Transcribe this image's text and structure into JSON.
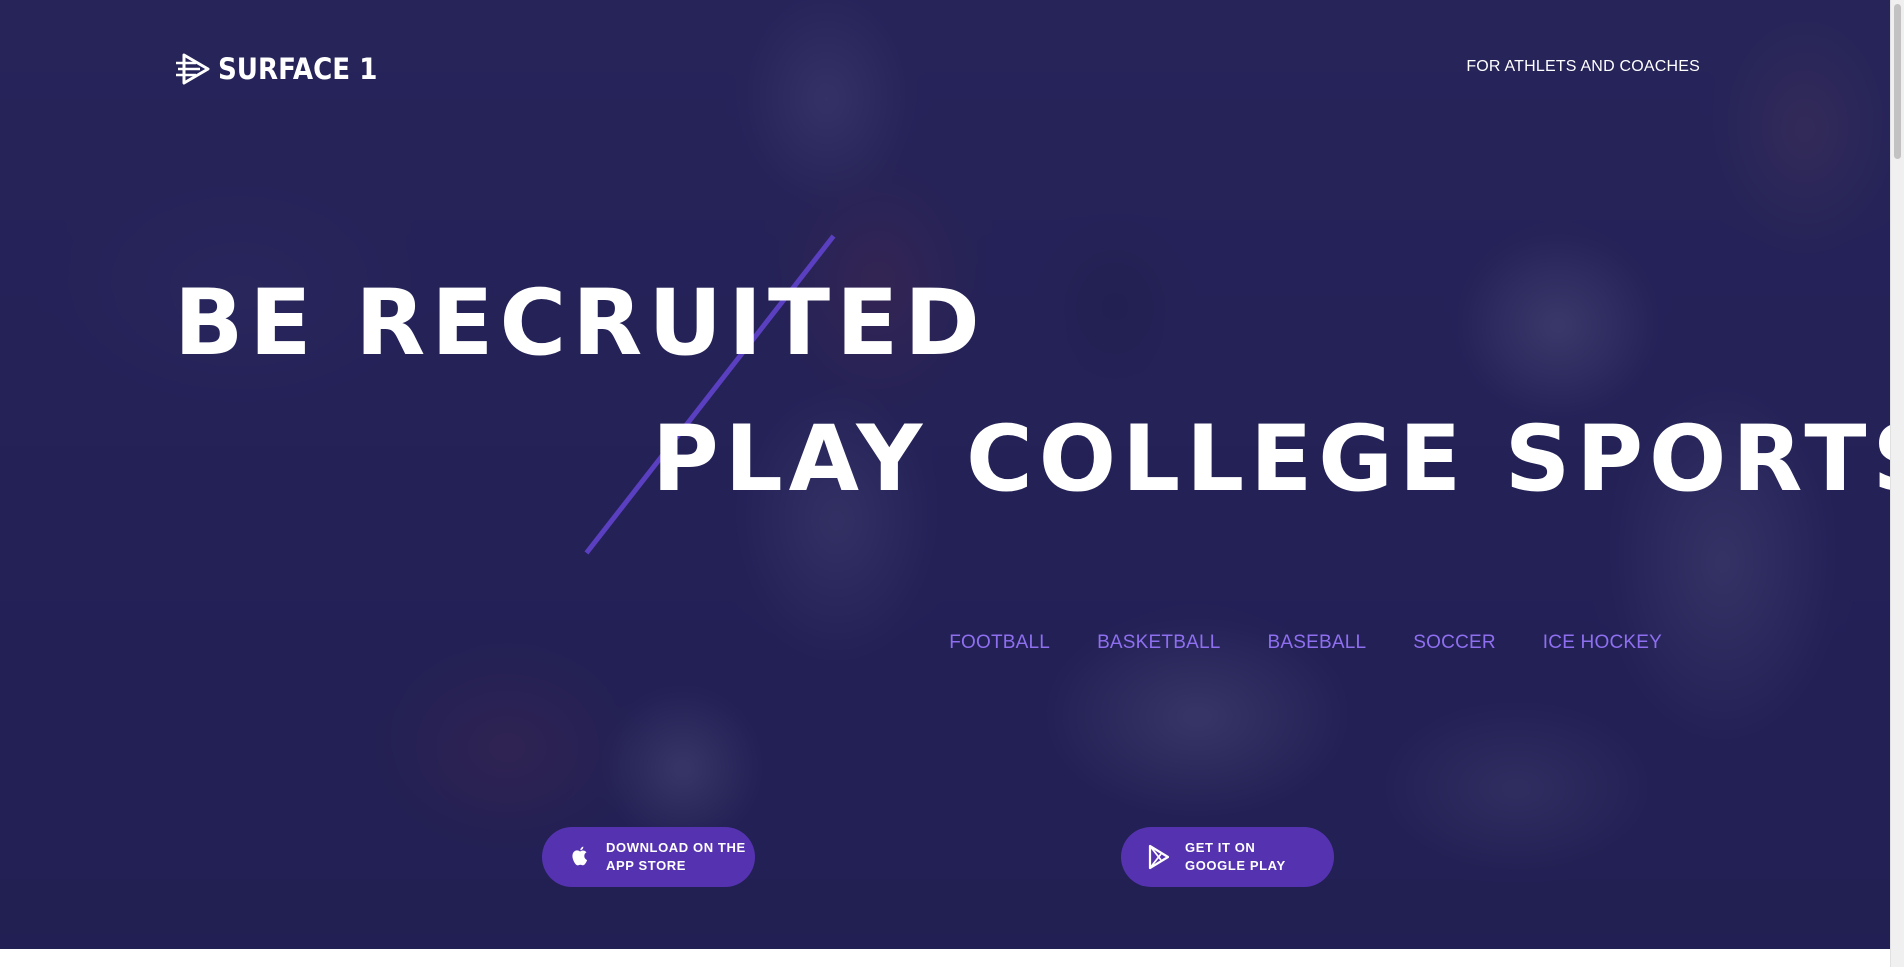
{
  "brand": {
    "name": "SURFACE 1",
    "logo_icon": "surface1-logo-icon"
  },
  "header": {
    "audience_link": "FOR ATHLETS AND COACHES"
  },
  "hero": {
    "headline_1": "BE RECRUITED",
    "headline_2": "PLAY COLLEGE SPORTS"
  },
  "sports": [
    {
      "label": "FOOTBALL"
    },
    {
      "label": "BASKETBALL"
    },
    {
      "label": "BASEBALL"
    },
    {
      "label": "SOCCER"
    },
    {
      "label": "ICE HOCKEY"
    }
  ],
  "downloads": {
    "appstore": {
      "icon": "apple-icon",
      "line_1": "DOWNLOAD ON THE",
      "line_2": "APP STORE"
    },
    "googleplay": {
      "icon": "google-play-icon",
      "line_1": "GET IT ON",
      "line_2": "GOOGLE PLAY"
    }
  },
  "colors": {
    "overlay": "#1f1c54",
    "accent": "#5a3fc0",
    "sport_link": "#8e6ff0",
    "button": "#5533b0",
    "text": "#ffffff"
  }
}
